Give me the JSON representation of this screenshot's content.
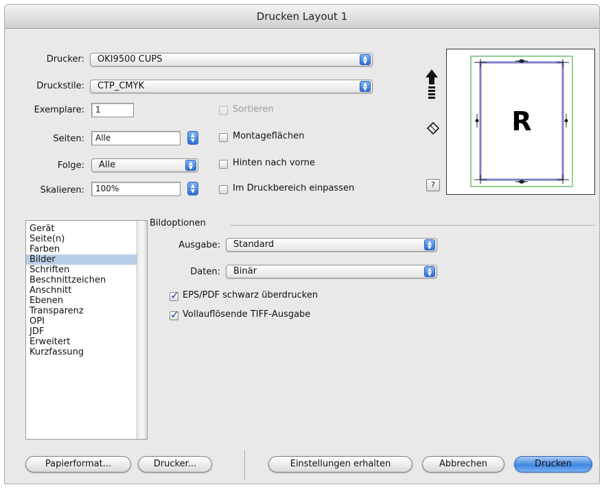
{
  "window": {
    "title": "Drucken Layout 1"
  },
  "top": {
    "drucker_label": "Drucker:",
    "drucker_value": "OKI9500 CUPS",
    "druckstile_label": "Druckstile:",
    "druckstile_value": "CTP_CMYK",
    "exemplare_label": "Exemplare:",
    "exemplare_value": "1",
    "seiten_label": "Seiten:",
    "seiten_value": "Alle",
    "folge_label": "Folge:",
    "folge_value": "Alle",
    "skalieren_label": "Skalieren:",
    "skalieren_value": "100%"
  },
  "checks": {
    "sortieren": {
      "label": "Sortieren",
      "checked": false,
      "enabled": false
    },
    "montageflaechen": {
      "label": "Montageflächen",
      "checked": false,
      "enabled": true
    },
    "hinten": {
      "label": "Hinten nach vorne",
      "checked": false,
      "enabled": true
    },
    "einpassen": {
      "label": "Im Druckbereich einpassen",
      "checked": false,
      "enabled": true
    }
  },
  "preview": {
    "letter": "R",
    "help": "?"
  },
  "sidebar": {
    "items": [
      "Gerät",
      "Seite(n)",
      "Farben",
      "Bilder",
      "Schriften",
      "Beschnittzeichen",
      "Anschnitt",
      "Ebenen",
      "Transparenz",
      "OPI",
      "JDF",
      "Erweitert",
      "Kurzfassung"
    ],
    "selected": "Bilder"
  },
  "bildoptionen": {
    "title": "Bildoptionen",
    "ausgabe_label": "Ausgabe:",
    "ausgabe_value": "Standard",
    "daten_label": "Daten:",
    "daten_value": "Binär",
    "eps_label": "EPS/PDF schwarz überdrucken",
    "eps_checked": true,
    "tiff_label": "Vollauflösende TIFF-Ausgabe",
    "tiff_checked": true
  },
  "buttons": {
    "papierformat": "Papierformat...",
    "drucker": "Drucker...",
    "einstellungen": "Einstellungen erhalten",
    "abbrechen": "Abbrechen",
    "drucken": "Drucken"
  },
  "colors": {
    "accent": "#3f86e0",
    "selection": "#b8cfe8",
    "preview_margin": "#7b7fc8",
    "preview_bleed": "#6fbf6f"
  }
}
